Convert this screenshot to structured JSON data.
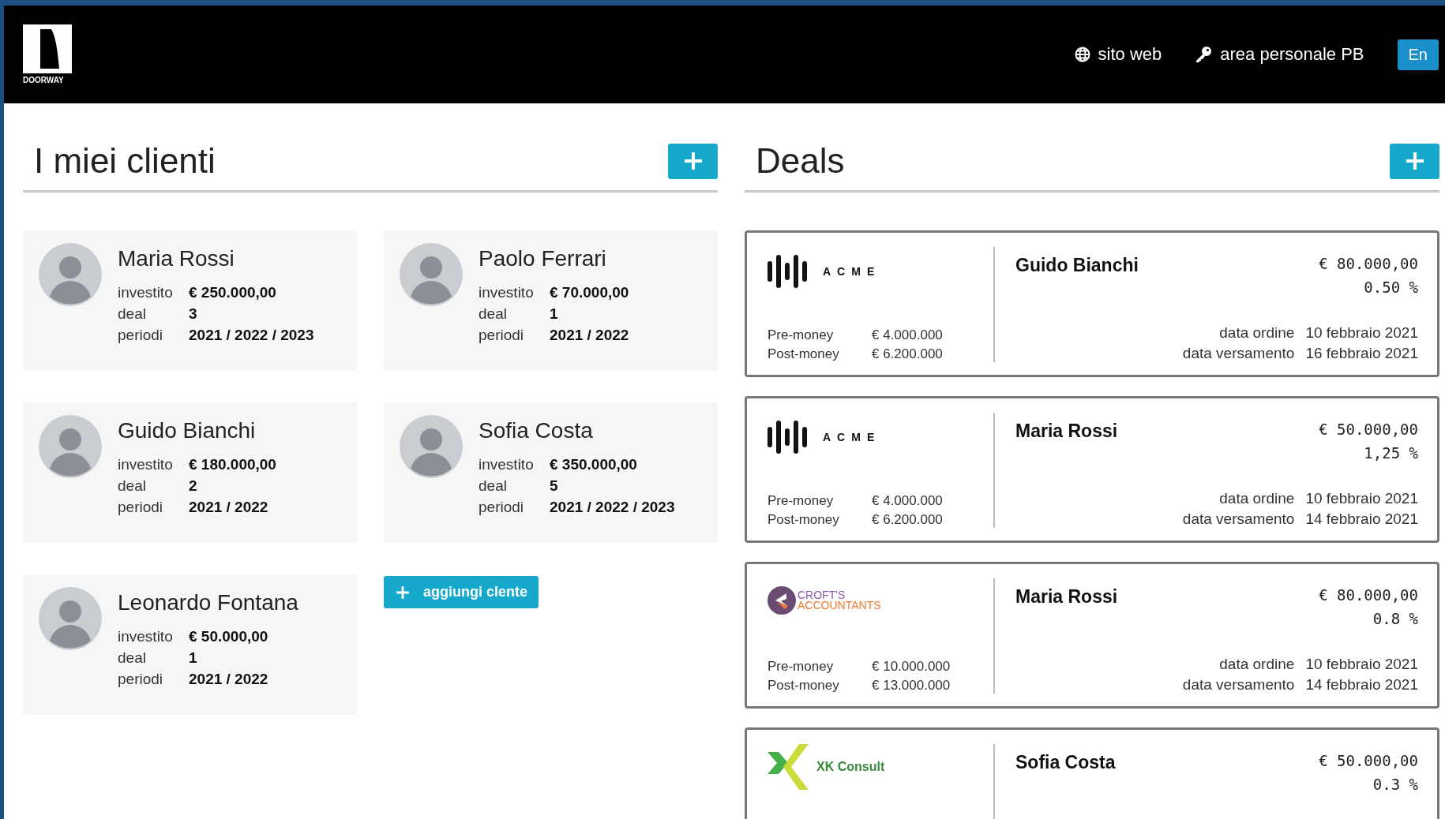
{
  "header": {
    "logo_text": "DOORWAY",
    "links": [
      {
        "kind": "globe",
        "label": "sito web"
      },
      {
        "kind": "key",
        "label": "area personale PB"
      }
    ],
    "language_button": "En"
  },
  "clients": {
    "title": "I miei clienti",
    "items": [
      {
        "name": "Maria Rossi",
        "stats": [
          {
            "label": "investito",
            "value": "€ 250.000,00"
          },
          {
            "label": "deal",
            "value": "3"
          },
          {
            "label": "periodi",
            "value": "2021 / 2022 / 2023"
          }
        ]
      },
      {
        "name": "Paolo Ferrari",
        "stats": [
          {
            "label": "investito",
            "value": "€ 70.000,00"
          },
          {
            "label": "deal",
            "value": "1"
          },
          {
            "label": "periodi",
            "value": "2021 / 2022"
          }
        ]
      },
      {
        "name": "Guido Bianchi",
        "stats": [
          {
            "label": "investito",
            "value": "€ 180.000,00"
          },
          {
            "label": "deal",
            "value": "2"
          },
          {
            "label": "periodi",
            "value": "2021 / 2022"
          }
        ]
      },
      {
        "name": "Sofia Costa",
        "stats": [
          {
            "label": "investito",
            "value": "€ 350.000,00"
          },
          {
            "label": "deal",
            "value": "5"
          },
          {
            "label": "periodi",
            "value": "2021 / 2022 / 2023"
          }
        ]
      },
      {
        "name": "Leonardo Fontana",
        "stats": [
          {
            "label": "investito",
            "value": "€ 50.000,00"
          },
          {
            "label": "deal",
            "value": "1"
          },
          {
            "label": "periodi",
            "value": "2021 / 2022"
          }
        ]
      }
    ],
    "add_button": "aggiungi clente"
  },
  "deals": {
    "title": "Deals",
    "items": [
      {
        "company": {
          "kind": "acme",
          "lines": [
            "ACME"
          ]
        },
        "money": [
          {
            "label": "Pre-money",
            "value": "€ 4.000.000"
          },
          {
            "label": "Post-money",
            "value": "€ 6.200.000"
          }
        ],
        "client": "Guido Bianchi",
        "amount": "€ 80.000,00",
        "share": "0.50 %",
        "dates": [
          {
            "label": "data ordine",
            "value": "10 febbraio 2021"
          },
          {
            "label": "data versamento",
            "value": "16 febbraio 2021"
          }
        ]
      },
      {
        "company": {
          "kind": "acme",
          "lines": [
            "ACME"
          ]
        },
        "money": [
          {
            "label": "Pre-money",
            "value": "€ 4.000.000"
          },
          {
            "label": "Post-money",
            "value": "€ 6.200.000"
          }
        ],
        "client": "Maria Rossi",
        "amount": "€ 50.000,00",
        "share": "1,25 %",
        "dates": [
          {
            "label": "data ordine",
            "value": "10 febbraio 2021"
          },
          {
            "label": "data versamento",
            "value": "14 febbraio 2021"
          }
        ]
      },
      {
        "company": {
          "kind": "crofts",
          "lines": [
            "CROFT'S",
            "ACCOUNTANTS"
          ]
        },
        "money": [
          {
            "label": "Pre-money",
            "value": "€ 10.000.000"
          },
          {
            "label": "Post-money",
            "value": "€ 13.000.000"
          }
        ],
        "client": "Maria Rossi",
        "amount": "€ 80.000,00",
        "share": "0.8 %",
        "dates": [
          {
            "label": "data ordine",
            "value": "10 febbraio 2021"
          },
          {
            "label": "data versamento",
            "value": "14 febbraio 2021"
          }
        ]
      },
      {
        "company": {
          "kind": "xk",
          "lines": [
            "XK Consult"
          ]
        },
        "client": "Sofia Costa",
        "amount": "€ 50.000,00",
        "share": "0.3 %"
      }
    ]
  }
}
